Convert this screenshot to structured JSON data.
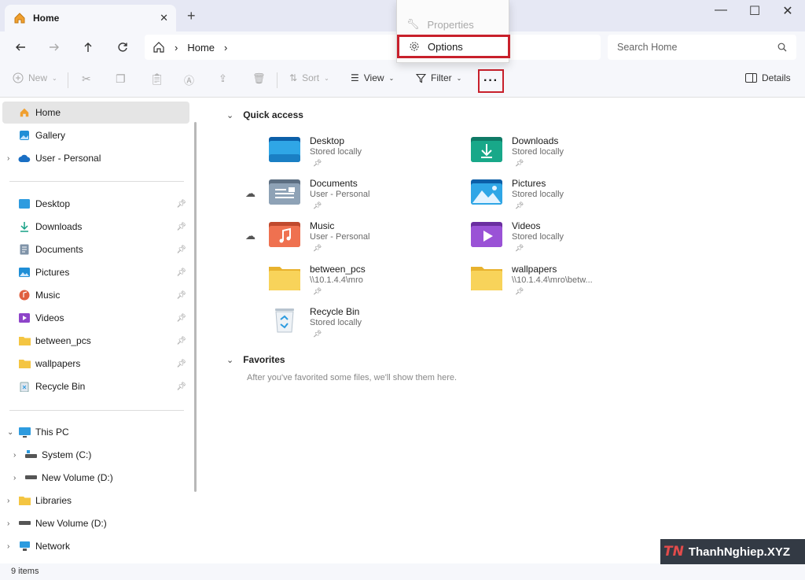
{
  "window": {
    "tab_label": "Home",
    "tab_close": "✕",
    "new_tab": "+",
    "minimize": "—",
    "maximize": "☐",
    "close": "✕"
  },
  "nav": {
    "breadcrumb_home": "Home",
    "search_placeholder": "Search Home"
  },
  "toolbar": {
    "new_label": "New",
    "sort_label": "Sort",
    "view_label": "View",
    "filter_label": "Filter",
    "more_label": "···",
    "details_label": "Details"
  },
  "menu": {
    "items": [
      {
        "label": "Properties",
        "enabled": false
      },
      {
        "label": "Options",
        "enabled": true
      }
    ]
  },
  "sidebar": {
    "top": [
      {
        "label": "Home",
        "icon": "home-icon",
        "selected": true
      },
      {
        "label": "Gallery",
        "icon": "gallery-icon"
      },
      {
        "label": "User - Personal",
        "icon": "cloud-icon",
        "expandable": true
      }
    ],
    "pinned": [
      {
        "label": "Desktop",
        "icon": "desktop-icon"
      },
      {
        "label": "Downloads",
        "icon": "download-icon"
      },
      {
        "label": "Documents",
        "icon": "documents-icon"
      },
      {
        "label": "Pictures",
        "icon": "pictures-icon"
      },
      {
        "label": "Music",
        "icon": "music-icon"
      },
      {
        "label": "Videos",
        "icon": "videos-icon"
      },
      {
        "label": "between_pcs",
        "icon": "folder-icon"
      },
      {
        "label": "wallpapers",
        "icon": "folder-icon"
      },
      {
        "label": "Recycle Bin",
        "icon": "recycle-bin-icon"
      }
    ],
    "devices": [
      {
        "label": "This PC",
        "icon": "pc-icon",
        "expanded": true
      },
      {
        "label": "System (C:)",
        "icon": "drive-icon",
        "child": true
      },
      {
        "label": "New Volume (D:)",
        "icon": "drive-icon",
        "child": true
      },
      {
        "label": "Libraries",
        "icon": "folder-icon"
      },
      {
        "label": "New Volume (D:)",
        "icon": "drive-icon"
      },
      {
        "label": "Network",
        "icon": "network-icon"
      }
    ]
  },
  "main": {
    "quick_access_title": "Quick access",
    "favorites_title": "Favorites",
    "favorites_empty": "After you've favorited some files, we'll show them here.",
    "quick_access": [
      {
        "name": "Desktop",
        "sub": "Stored locally",
        "icon": "desktop-folder-icon",
        "color": "#1f8ed6",
        "cloud": false
      },
      {
        "name": "Downloads",
        "sub": "Stored locally",
        "icon": "downloads-folder-icon",
        "color": "#16a085",
        "cloud": false
      },
      {
        "name": "Documents",
        "sub": "User - Personal",
        "icon": "documents-folder-icon",
        "color": "#7f93a8",
        "cloud": true
      },
      {
        "name": "Pictures",
        "sub": "Stored locally",
        "icon": "pictures-folder-icon",
        "color": "#1f8ed6",
        "cloud": false
      },
      {
        "name": "Music",
        "sub": "User - Personal",
        "icon": "music-folder-icon",
        "color": "#e0603f",
        "cloud": true
      },
      {
        "name": "Videos",
        "sub": "Stored locally",
        "icon": "videos-folder-icon",
        "color": "#8e44c9",
        "cloud": false
      },
      {
        "name": "between_pcs",
        "sub": "\\\\10.1.4.4\\mro",
        "icon": "folder-icon",
        "color": "#f4c542",
        "cloud": false
      },
      {
        "name": "wallpapers",
        "sub": "\\\\10.1.4.4\\mro\\betw...",
        "icon": "folder-icon",
        "color": "#f4c542",
        "cloud": false
      },
      {
        "name": "Recycle Bin",
        "sub": "Stored locally",
        "icon": "recycle-bin-icon",
        "color": "#4aa3df",
        "cloud": false
      }
    ]
  },
  "status": {
    "items_count": "9 items"
  },
  "watermark": {
    "logo": "TN",
    "text": "ThanhNghiep.XYZ"
  },
  "colors": {
    "highlight": "#c8202b",
    "accent": "#1f8ed6"
  }
}
